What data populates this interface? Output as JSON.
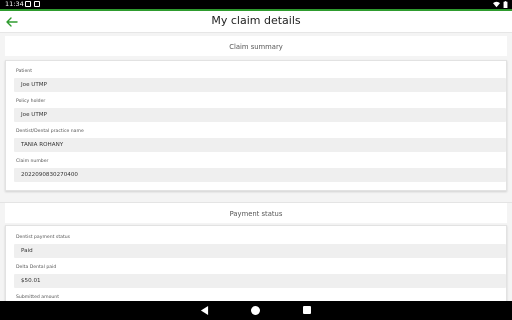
{
  "status_bar": {
    "time": "11:34"
  },
  "app_bar": {
    "title": "My claim details"
  },
  "claim_summary": {
    "heading": "Claim summary",
    "fields": [
      {
        "label": "Patient",
        "value": "Joe UTMP"
      },
      {
        "label": "Policy holder",
        "value": "Joe UTMP"
      },
      {
        "label": "Dentist/Dental practice name",
        "value": "TANIA ROHANY"
      },
      {
        "label": "Claim number",
        "value": "2022090830270400"
      }
    ]
  },
  "payment_status": {
    "heading": "Payment status",
    "fields": [
      {
        "label": "Dentist payment status",
        "value": "Paid"
      },
      {
        "label": "Delta Dental paid",
        "value": "$50.01"
      },
      {
        "label": "Submitted amount",
        "value": ""
      }
    ]
  },
  "colors": {
    "accent": "#2e9b2e"
  },
  "icons": {
    "back": "arrow-left-icon",
    "nav_back": "triangle-back-icon",
    "nav_home": "circle-home-icon",
    "nav_recent": "square-recents-icon"
  }
}
